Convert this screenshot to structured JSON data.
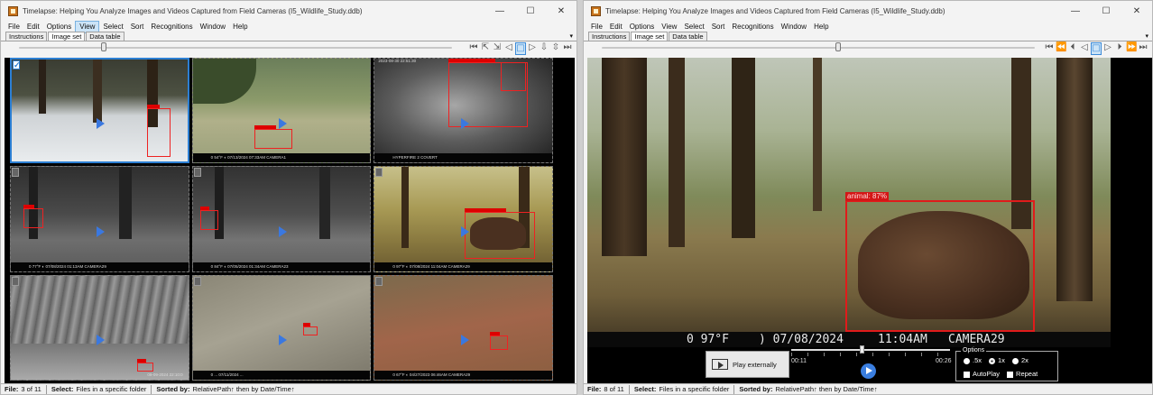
{
  "app_title": "Timelapse: Helping You Analyze Images and Videos Captured from Field Cameras (I5_Wildlife_Study.ddb)",
  "menu": [
    "File",
    "Edit",
    "Options",
    "View",
    "Select",
    "Sort",
    "Recognitions",
    "Window",
    "Help"
  ],
  "menu_active_left": "View",
  "tabs": [
    "Instructions",
    "Image set",
    "Data table"
  ],
  "selected_tab": "Image set",
  "window_controls": {
    "minimize": "—",
    "maximize": "☐",
    "close": "✕"
  },
  "tab_scroll_glyph": "▾",
  "nav_buttons_left": [
    "⏮",
    "⇱",
    "⇲",
    "◁",
    "□",
    "▷",
    "⇩",
    "⇳",
    "⏭"
  ],
  "nav_buttons_right": [
    "⏮",
    "⏪",
    "⏴",
    "◁",
    "□",
    "▷",
    "⏵",
    "⏩",
    "⏭"
  ],
  "left_window": {
    "slider_position": 0.19,
    "grid": [
      {
        "checked": true,
        "caption": "",
        "selected": true,
        "bg": "snow"
      },
      {
        "checked": false,
        "caption": "0  54°F  ◐ 07/13/2024  07:33AM  CAMERA1",
        "bg": "grass"
      },
      {
        "checked": false,
        "caption": "HYPERFIRE 2 COVERT",
        "top_caption": "2023-08-30 22:51:30",
        "bg": "night-elk"
      },
      {
        "checked": false,
        "caption": "0  77°F  ◐ 07/08/2024  01:13AM  CAMERA29",
        "bg": "forest-night"
      },
      {
        "checked": false,
        "caption": "0  84°F  ◐ 07/05/2024  01:34AM  CAMERA23",
        "bg": "forest-night2"
      },
      {
        "checked": false,
        "caption": "0  97°F  ◐ 07/08/2024  11:04AM  CAMERA29",
        "bg": "forest-bear"
      },
      {
        "checked": false,
        "caption": "09-09-2024 22:10:0",
        "bg": "bw-wood"
      },
      {
        "checked": false,
        "caption": "0  ...  07/11/2024  ...",
        "bg": "rocky"
      },
      {
        "checked": false,
        "caption": "0  67°F  ◐ 04/27/2023  06:46AM  CAMERA29",
        "bg": "red-dirt"
      }
    ],
    "status": {
      "file_label": "File:",
      "file_value": "3 of 11",
      "select_label": "Select:",
      "select_value": "Files in a specific folder",
      "sorted_label": "Sorted by:",
      "sorted_value": "RelativePath↑ then by Date/Time↑"
    }
  },
  "right_window": {
    "slider_position": 0.54,
    "detection_label": "animal: 87%",
    "video_caption": {
      "temp": "0  97°F",
      "date": ")  07/08/2024",
      "time": "11:04AM",
      "camera": "CAMERA29"
    },
    "play_externally": "Play externally",
    "time_start": "00:11",
    "time_end": "00:26",
    "progress": 0.43,
    "options": {
      "legend": "Options",
      "speeds": [
        ".5x",
        "1x",
        "2x"
      ],
      "selected_speed": "1x",
      "autoplay": "AutoPlay",
      "repeat": "Repeat"
    },
    "status": {
      "file_label": "File:",
      "file_value": "8 of 11",
      "select_label": "Select:",
      "select_value": "Files in a specific folder",
      "sorted_label": "Sorted by:",
      "sorted_value": "RelativePath↑ then by Date/Time↑"
    }
  }
}
